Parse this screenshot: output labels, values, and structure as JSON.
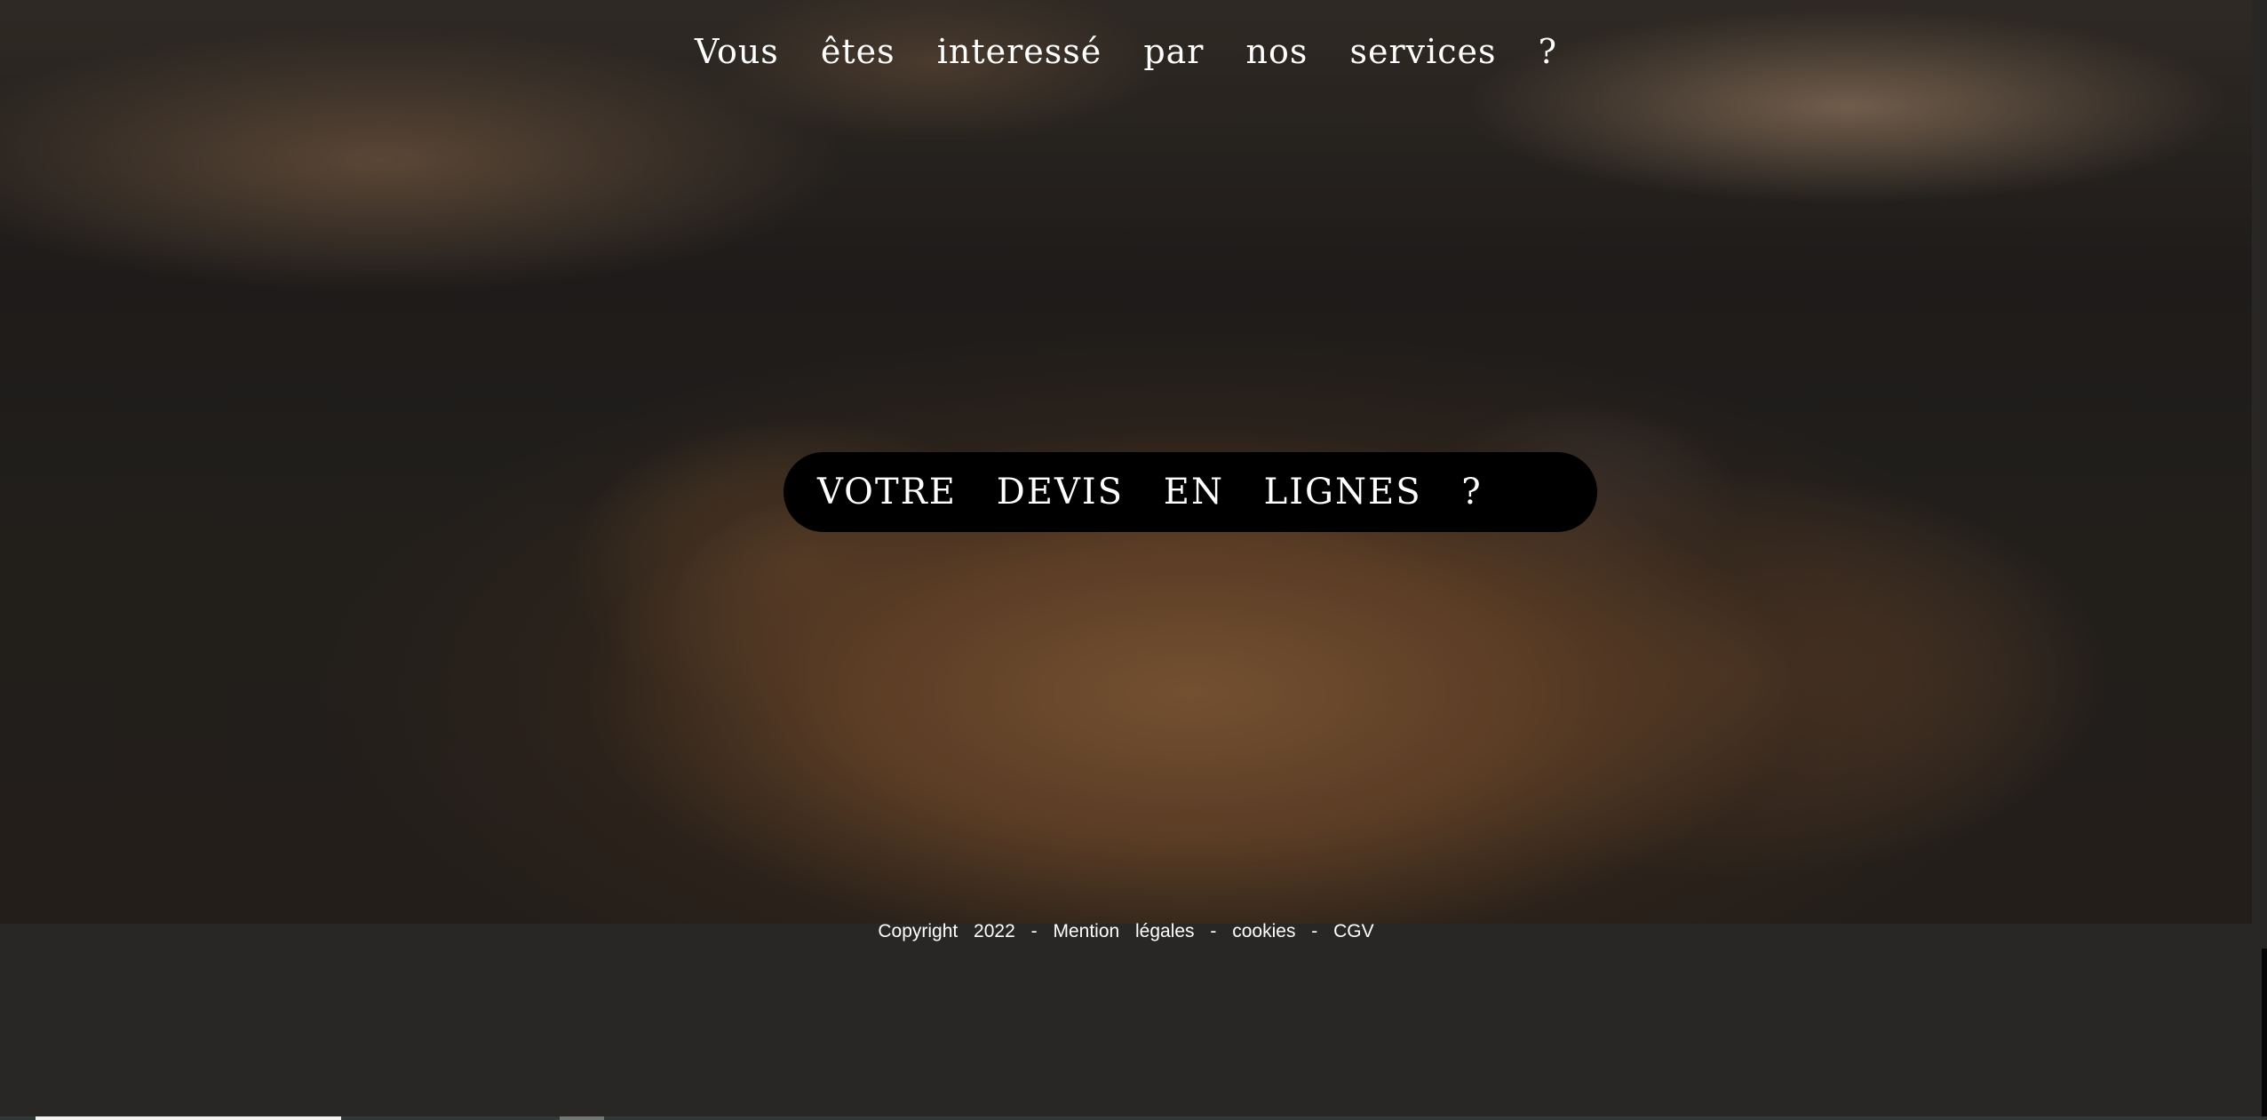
{
  "hero": {
    "headline": "Vous êtes interessé par nos services ?",
    "cta_label": "VOTRE DEVIS EN LIGNES ?"
  },
  "footer": {
    "copyright": "Copyright 2022",
    "sep1": "-",
    "mentions": "Mention légales",
    "sep2": "-",
    "cookies": "cookies",
    "sep3": "-",
    "cgv": "CGV"
  },
  "colors": {
    "page_background": "#282725",
    "cta_background": "#000000",
    "text": "#ffffff"
  }
}
